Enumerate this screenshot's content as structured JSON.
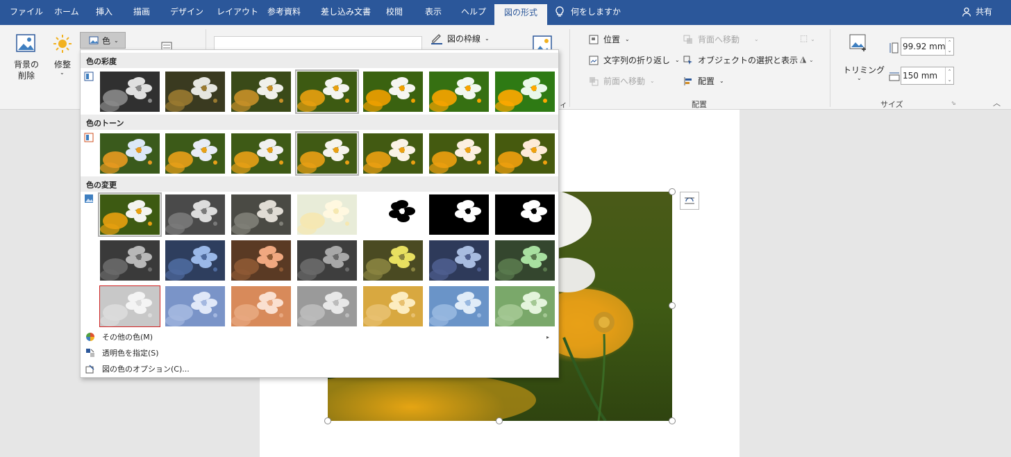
{
  "tabs": [
    {
      "label": "ファイル",
      "active": false
    },
    {
      "label": "ホーム",
      "active": false
    },
    {
      "label": "挿入",
      "active": false
    },
    {
      "label": "描画",
      "active": false
    },
    {
      "label": "デザイン",
      "active": false
    },
    {
      "label": "レイアウト",
      "active": false
    },
    {
      "label": "参考資料",
      "active": false
    },
    {
      "label": "差し込み文書",
      "active": false
    },
    {
      "label": "校閲",
      "active": false
    },
    {
      "label": "表示",
      "active": false
    },
    {
      "label": "ヘルプ",
      "active": false
    },
    {
      "label": "図の形式",
      "active": true
    }
  ],
  "tell_me": "何をしますか",
  "share": "共有",
  "ribbon": {
    "remove_bg_line1": "背景の",
    "remove_bg_line2": "削除",
    "corrections": "修整",
    "color": "色",
    "picture_border": "図の枠線",
    "position": "位置",
    "wrap_text": "文字列の折り返し",
    "bring_forward": "前面へ移動",
    "send_backward": "背面へ移動",
    "selection_pane": "オブジェクトの選択と表示",
    "align": "配置",
    "arrange_group": "配置",
    "crop": "トリミング",
    "size_group": "サイズ",
    "height": "99.92 mm",
    "width": "150 mm",
    "partial_group_char": "ィ"
  },
  "menu": {
    "saturation_header": "色の彩度",
    "tone_header": "色のトーン",
    "recolor_header": "色の変更",
    "more_colors": "その他の色(M)",
    "more_colors_key": "M",
    "transparent": "透明色を指定(S)",
    "options": "図の色のオプション(C)..."
  },
  "colors": {
    "accent": "#2b579a",
    "focus_outline": "#d02020"
  }
}
